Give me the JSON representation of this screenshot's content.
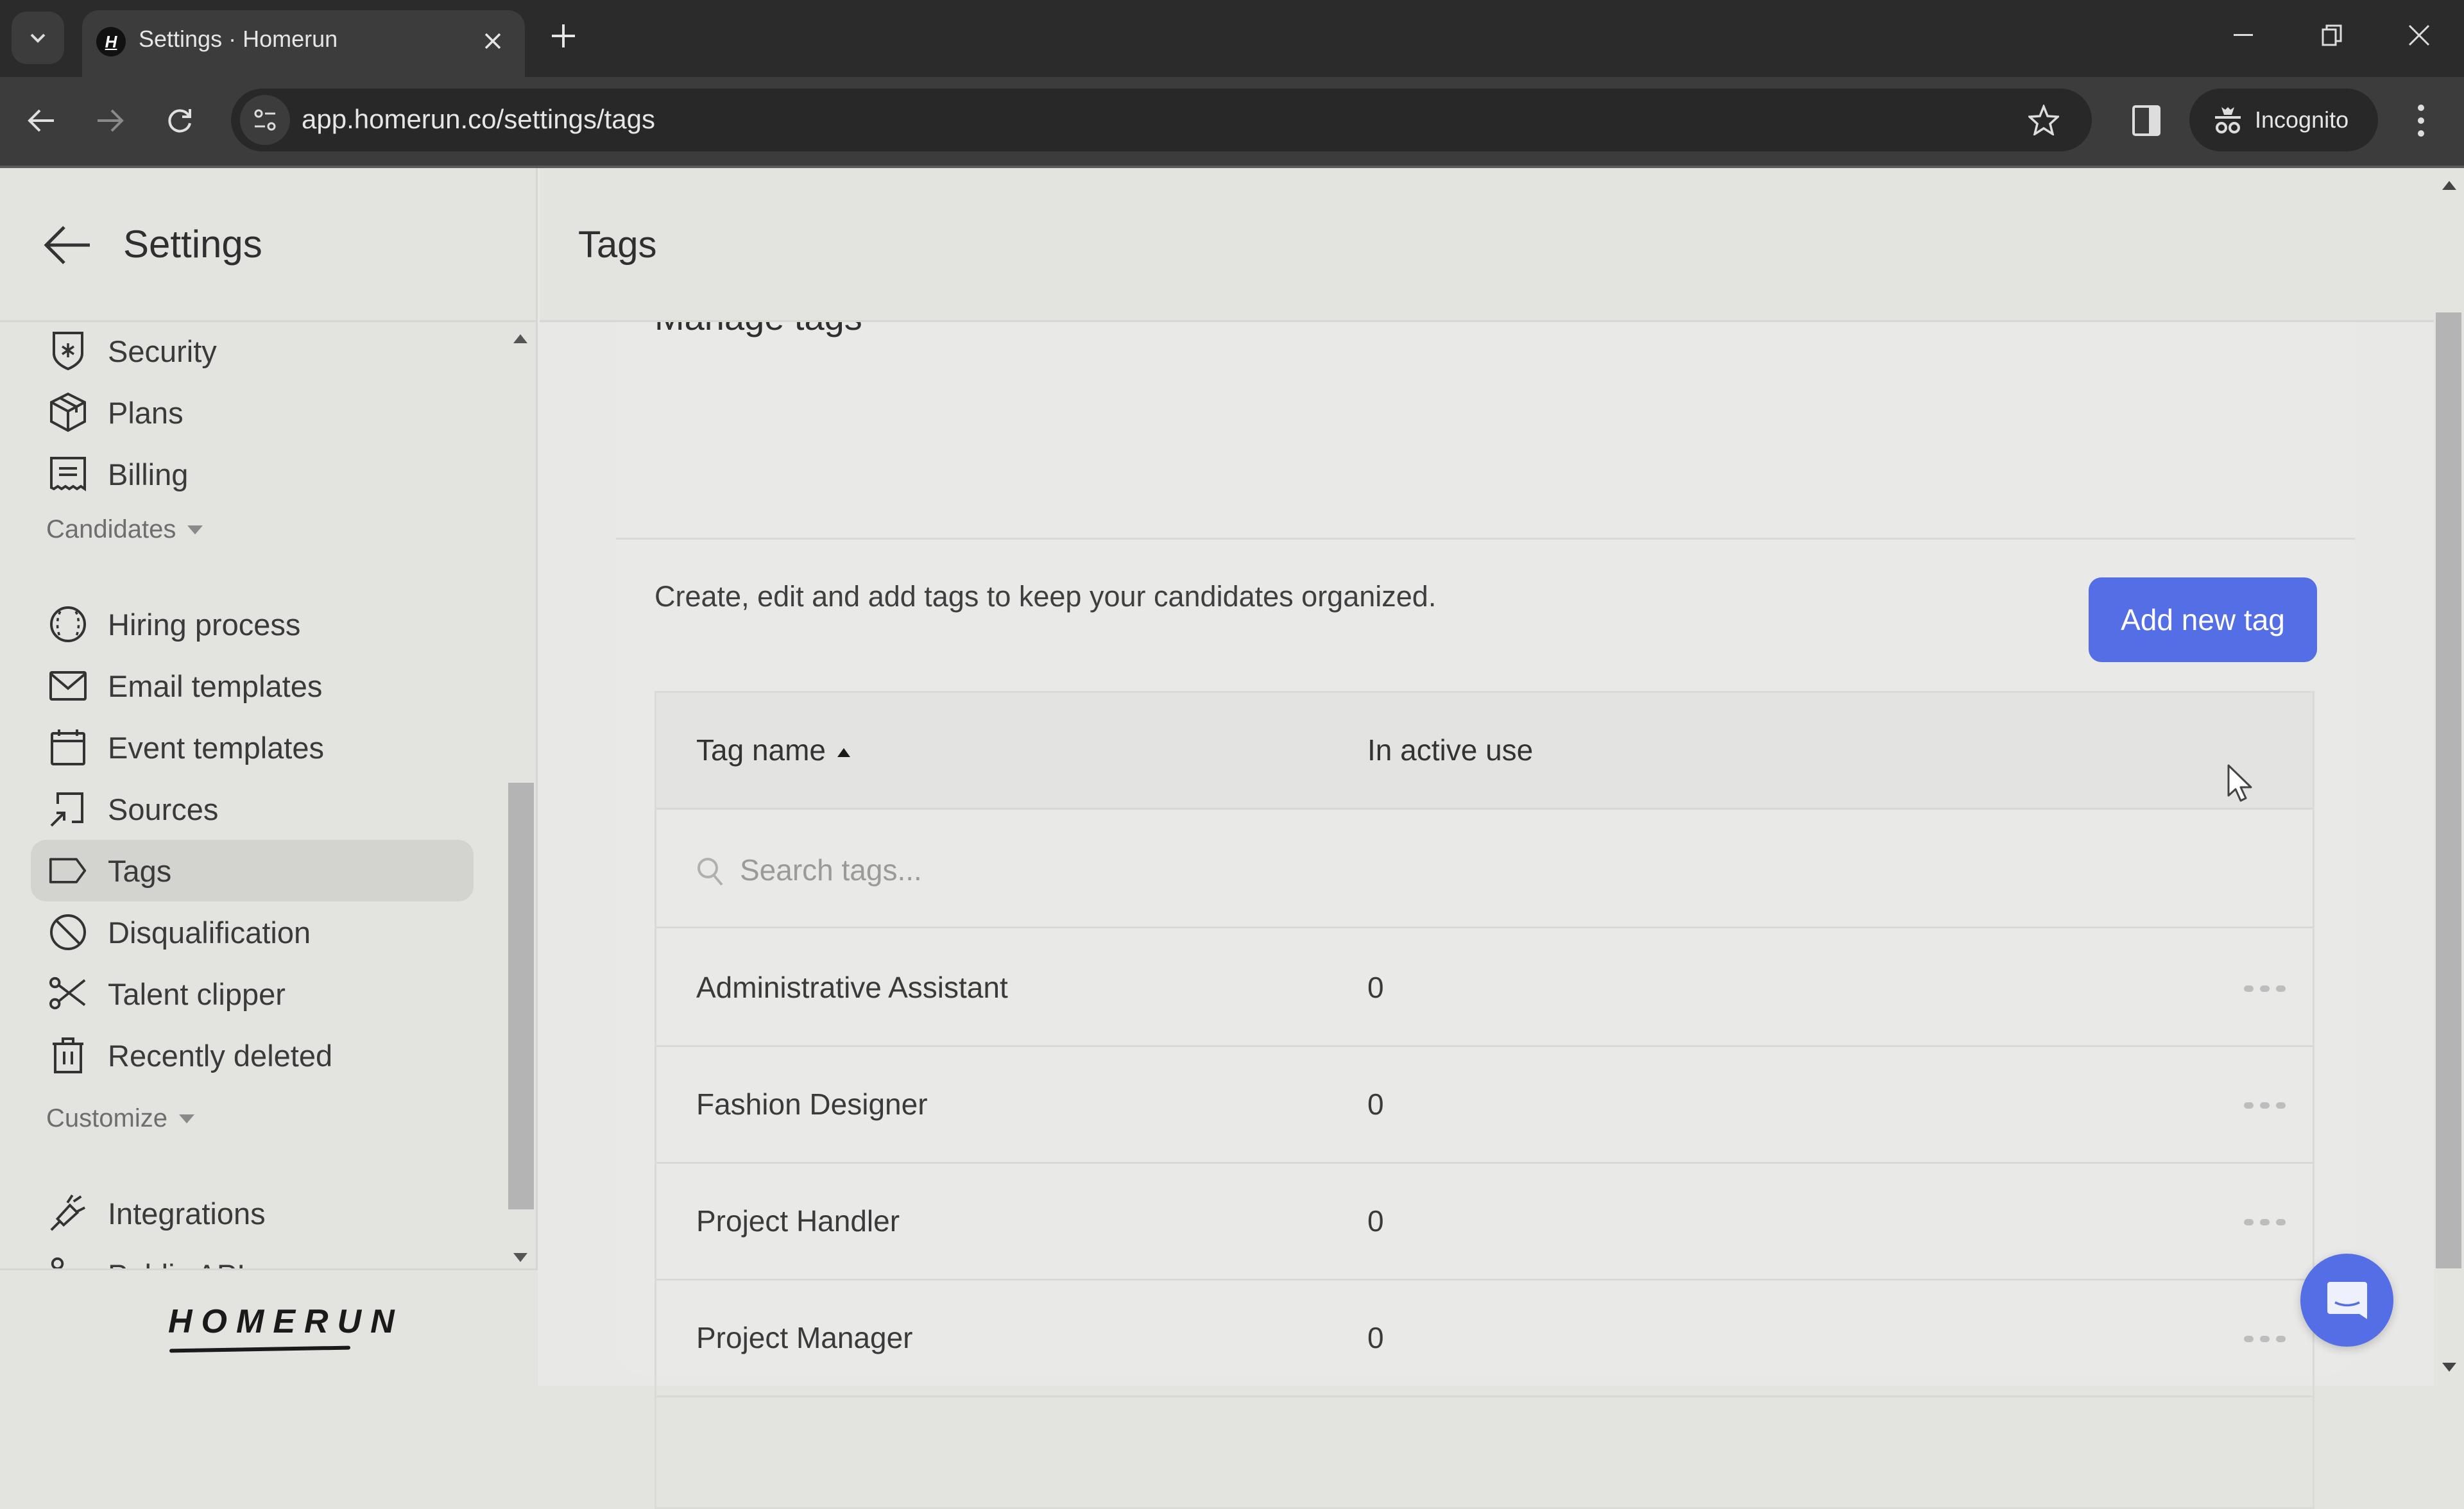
{
  "browser": {
    "tab_title": "Settings · Homerun",
    "favicon_letter": "H",
    "url": "app.homerun.co/settings/tags",
    "incognito_label": "Incognito"
  },
  "sidebar": {
    "title": "Settings",
    "items_top": [
      {
        "label": "Security",
        "icon": "shield-icon"
      },
      {
        "label": "Plans",
        "icon": "box-icon"
      },
      {
        "label": "Billing",
        "icon": "receipt-icon"
      }
    ],
    "sections": [
      {
        "label": "Candidates",
        "items": [
          {
            "label": "Hiring process",
            "icon": "baseball-icon"
          },
          {
            "label": "Email templates",
            "icon": "envelope-icon"
          },
          {
            "label": "Event templates",
            "icon": "calendar-icon"
          },
          {
            "label": "Sources",
            "icon": "source-arrow-icon"
          },
          {
            "label": "Tags",
            "icon": "tag-icon",
            "active": true
          },
          {
            "label": "Disqualification",
            "icon": "ban-icon"
          },
          {
            "label": "Talent clipper",
            "icon": "scissors-icon"
          },
          {
            "label": "Recently deleted",
            "icon": "trash-icon"
          }
        ]
      },
      {
        "label": "Customize",
        "items": [
          {
            "label": "Integrations",
            "icon": "plug-icon"
          },
          {
            "label": "Public API",
            "icon": "api-icon"
          }
        ]
      }
    ],
    "logo": "HOMERUN"
  },
  "main": {
    "title": "Tags",
    "card_title": "Manage tags",
    "description": "Create, edit and add tags to keep your candidates organized.",
    "add_button": "Add new tag",
    "accent_color": "#546ee5",
    "table": {
      "columns": [
        "Tag name",
        "In active use"
      ],
      "sort": {
        "column": "Tag name",
        "direction": "ascending"
      },
      "search_placeholder": "Search tags...",
      "search_value": "",
      "rows": [
        {
          "name": "Administrative Assistant",
          "count": "0"
        },
        {
          "name": "Fashion Designer",
          "count": "0"
        },
        {
          "name": "Project Handler",
          "count": "0"
        },
        {
          "name": "Project Manager",
          "count": "0"
        }
      ]
    }
  }
}
